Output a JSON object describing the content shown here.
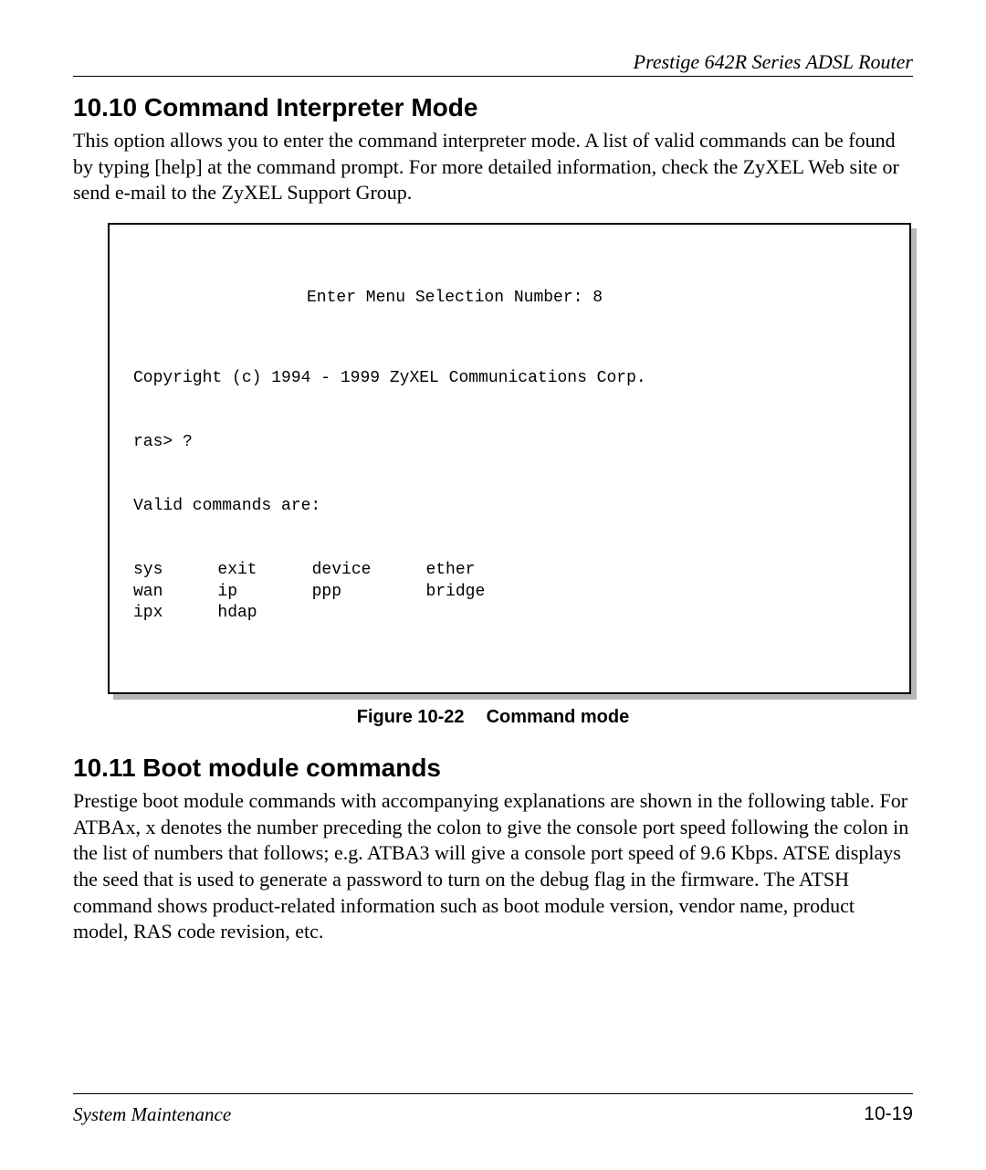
{
  "running_head": "Prestige 642R Series ADSL Router",
  "section1": {
    "heading": "10.10 Command Interpreter Mode",
    "paragraph": "This option allows you to enter the command interpreter mode. A list of valid commands can be found by typing [help] at the command prompt. For more detailed information, check the ZyXEL Web site or send e-mail to the ZyXEL Support Group."
  },
  "terminal": {
    "menu_line": "Enter Menu Selection Number: 8",
    "copyright": "Copyright (c) 1994 - 1999 ZyXEL Communications Corp.",
    "prompt": "ras> ?",
    "valid_label": "Valid commands are:",
    "rows": [
      [
        "sys",
        "exit",
        "device",
        "ether"
      ],
      [
        "wan",
        "ip",
        "ppp",
        "bridge"
      ],
      [
        "ipx",
        "hdap",
        "",
        ""
      ]
    ]
  },
  "figure_caption": {
    "label": "Figure 10-22",
    "title": "Command mode"
  },
  "section2": {
    "heading": "10.11 Boot module commands",
    "paragraph": "Prestige boot module commands with accompanying explanations are shown in the following table. For ATBAx, x denotes the number preceding the colon to give the console port speed following the colon in the list of numbers that follows; e.g. ATBA3 will give a console port speed of 9.6 Kbps.  ATSE displays the seed that is used to generate a password to turn on the debug flag in the firmware. The ATSH command shows product-related information such as boot module version, vendor name, product model, RAS code revision, etc."
  },
  "footer": {
    "left": "System Maintenance",
    "right": "10-19"
  }
}
